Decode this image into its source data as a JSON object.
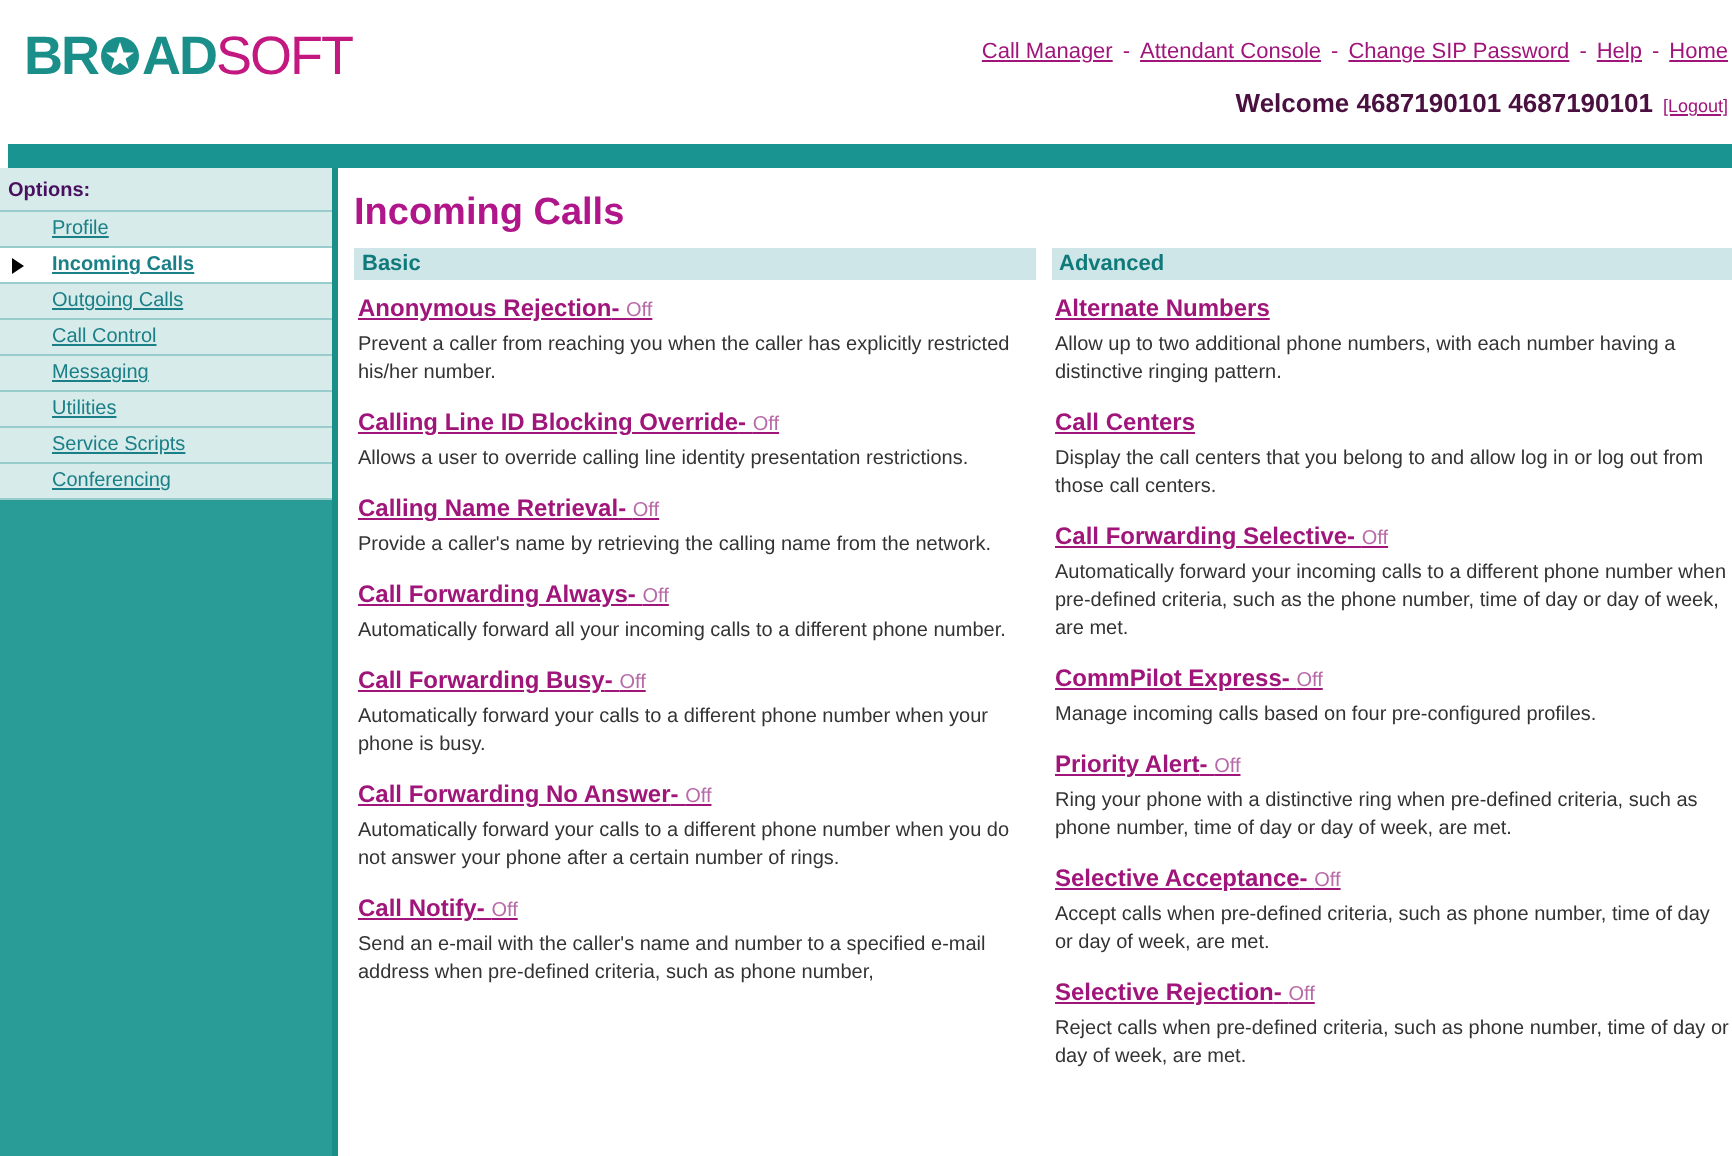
{
  "logo": {
    "part_1": "BR",
    "part_2": "AD",
    "part_3": "SOFT"
  },
  "top_links": [
    "Call Manager",
    "Attendant Console",
    "Change SIP Password",
    "Help",
    "Home"
  ],
  "link_separator": "-",
  "welcome": "Welcome 4687190101 4687190101",
  "logout": "[Logout]",
  "status_separator": "-",
  "sidebar": {
    "title": "Options:",
    "items": [
      {
        "label": "Profile",
        "selected": false
      },
      {
        "label": "Incoming Calls",
        "selected": true
      },
      {
        "label": "Outgoing Calls",
        "selected": false
      },
      {
        "label": "Call Control",
        "selected": false
      },
      {
        "label": "Messaging",
        "selected": false
      },
      {
        "label": "Utilities",
        "selected": false
      },
      {
        "label": "Service Scripts",
        "selected": false
      },
      {
        "label": "Conferencing",
        "selected": false
      }
    ]
  },
  "page_title": "Incoming Calls",
  "columns": [
    {
      "heading": "Basic",
      "services": [
        {
          "name": "Anonymous Rejection",
          "status": "Off",
          "description": "Prevent a caller from reaching you when the caller has explicitly restricted his/her number."
        },
        {
          "name": "Calling Line ID Blocking Override",
          "status": "Off",
          "description": "Allows a user to override calling line identity presentation restrictions."
        },
        {
          "name": "Calling Name Retrieval",
          "status": "Off",
          "description": "Provide a caller's name by retrieving the calling name from the network."
        },
        {
          "name": "Call Forwarding Always",
          "status": "Off",
          "description": "Automatically forward all your incoming calls to a different phone number."
        },
        {
          "name": "Call Forwarding Busy",
          "status": "Off",
          "description": "Automatically forward your calls to a different phone number when your phone is busy."
        },
        {
          "name": "Call Forwarding No Answer",
          "status": "Off",
          "description": "Automatically forward your calls to a different phone number when you do not answer your phone after a certain number of rings."
        },
        {
          "name": "Call Notify",
          "status": "Off",
          "description": "Send an e-mail with the caller's name and number to a specified e-mail address when pre-defined criteria, such as phone number,"
        }
      ]
    },
    {
      "heading": "Advanced",
      "services": [
        {
          "name": "Alternate Numbers",
          "description": "Allow up to two additional phone numbers, with each number having a distinctive ringing pattern."
        },
        {
          "name": "Call Centers",
          "description": "Display the call centers that you belong to and allow log in or log out from those call centers."
        },
        {
          "name": "Call Forwarding Selective",
          "status": "Off",
          "description": "Automatically forward your incoming calls to a different phone number when pre-defined criteria, such as the phone number, time of day or day of week, are met."
        },
        {
          "name": "CommPilot Express",
          "status": "Off",
          "description": "Manage incoming calls based on four pre-configured profiles."
        },
        {
          "name": "Priority Alert",
          "status": "Off",
          "description": "Ring your phone with a distinctive ring when pre-defined criteria, such as phone number, time of day or day of week, are met."
        },
        {
          "name": "Selective Acceptance",
          "status": "Off",
          "description": "Accept calls when pre-defined criteria, such as phone number, time of day or day of week, are met."
        },
        {
          "name": "Selective Rejection",
          "status": "Off",
          "description": "Reject calls when pre-defined criteria, such as phone number, time of day or day of week, are met."
        }
      ]
    }
  ]
}
